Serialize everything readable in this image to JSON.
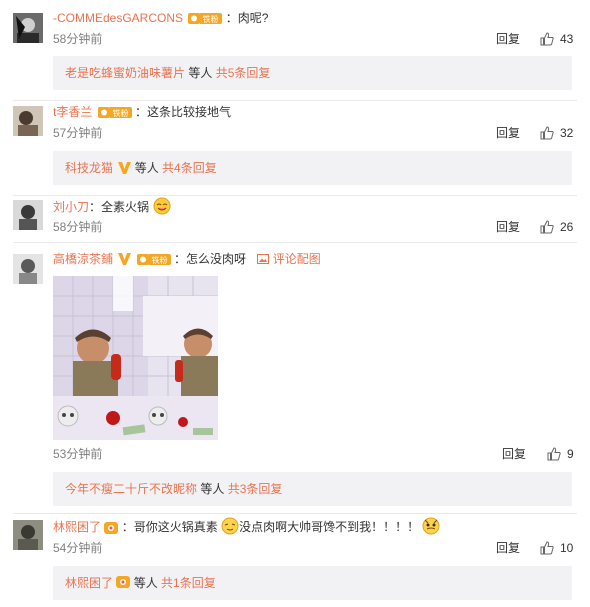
{
  "comments": [
    {
      "username": "-COMMEdesGARCONS",
      "badge": "铁粉",
      "text": "：肉呢?",
      "time": "58分钟前",
      "reply_label": "回复",
      "likes": "43",
      "sub": {
        "user": "老是吃蜂蜜奶油味薯片",
        "mid": " 等人 ",
        "count": "共5条回复"
      }
    },
    {
      "username": "t李香兰",
      "badge": "铁粉",
      "text": "：这条比较接地气",
      "time": "57分钟前",
      "reply_label": "回复",
      "likes": "32",
      "sub": {
        "user": "科技龙猫",
        "mid": " 等人 ",
        "count": "共4条回复"
      }
    },
    {
      "username": "刘小刀",
      "text": "：全素火锅",
      "time": "58分钟前",
      "reply_label": "回复",
      "likes": "26"
    },
    {
      "username": "高橋涼茶鋪",
      "badge": "铁粉",
      "text": "：怎么没肉呀",
      "pic_link": "评论配图",
      "time": "53分钟前",
      "reply_label": "回复",
      "likes": "9",
      "sub": {
        "user": "今年不瘦二十斤不改昵称",
        "mid": " 等人 ",
        "count": "共3条回复"
      }
    },
    {
      "username": "林熙困了",
      "text": "：哥你这火锅真素",
      "text2": "没点肉啊大帅哥馋不到我！！！！",
      "time": "54分钟前",
      "reply_label": "回复",
      "likes": "10",
      "sub": {
        "user": "林熙困了",
        "mid": " 等人 ",
        "count": "共1条回复"
      }
    }
  ],
  "colors": {
    "username": "#eb7350",
    "sub_bg": "#f2f2f5",
    "time": "#808080",
    "vip_gold": "#f5a623"
  },
  "icons": [
    "thumb-up-icon",
    "vip-v-icon",
    "fan-badge-icon",
    "picture-icon",
    "emoji-icon"
  ]
}
